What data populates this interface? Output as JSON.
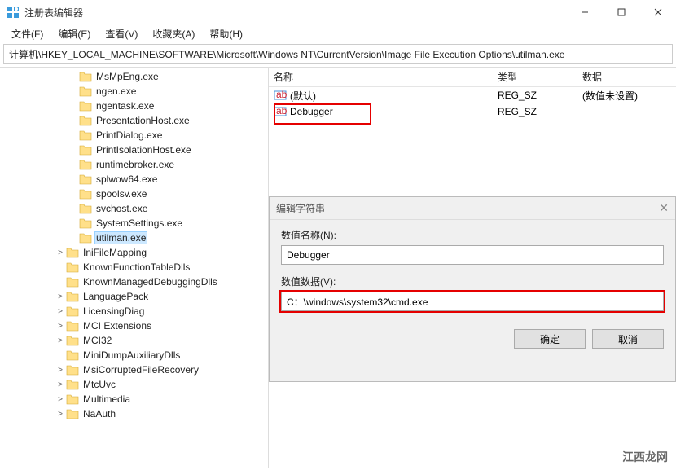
{
  "titlebar": {
    "title": "注册表编辑器"
  },
  "menu": {
    "file": "文件(F)",
    "edit": "编辑(E)",
    "view": "查看(V)",
    "favorites": "收藏夹(A)",
    "help": "帮助(H)"
  },
  "address": "计算机\\HKEY_LOCAL_MACHINE\\SOFTWARE\\Microsoft\\Windows NT\\CurrentVersion\\Image File Execution Options\\utilman.exe",
  "tree": [
    {
      "indent": 5,
      "expand": "",
      "label": "MsMpEng.exe"
    },
    {
      "indent": 5,
      "expand": "",
      "label": "ngen.exe"
    },
    {
      "indent": 5,
      "expand": "",
      "label": "ngentask.exe"
    },
    {
      "indent": 5,
      "expand": "",
      "label": "PresentationHost.exe"
    },
    {
      "indent": 5,
      "expand": "",
      "label": "PrintDialog.exe"
    },
    {
      "indent": 5,
      "expand": "",
      "label": "PrintIsolationHost.exe"
    },
    {
      "indent": 5,
      "expand": "",
      "label": "runtimebroker.exe"
    },
    {
      "indent": 5,
      "expand": "",
      "label": "splwow64.exe"
    },
    {
      "indent": 5,
      "expand": "",
      "label": "spoolsv.exe"
    },
    {
      "indent": 5,
      "expand": "",
      "label": "svchost.exe"
    },
    {
      "indent": 5,
      "expand": "",
      "label": "SystemSettings.exe"
    },
    {
      "indent": 5,
      "expand": "",
      "label": "utilman.exe",
      "selected": true
    },
    {
      "indent": 4,
      "expand": ">",
      "label": "IniFileMapping"
    },
    {
      "indent": 4,
      "expand": "",
      "label": "KnownFunctionTableDlls"
    },
    {
      "indent": 4,
      "expand": "",
      "label": "KnownManagedDebuggingDlls"
    },
    {
      "indent": 4,
      "expand": ">",
      "label": "LanguagePack"
    },
    {
      "indent": 4,
      "expand": ">",
      "label": "LicensingDiag"
    },
    {
      "indent": 4,
      "expand": ">",
      "label": "MCI Extensions"
    },
    {
      "indent": 4,
      "expand": ">",
      "label": "MCI32"
    },
    {
      "indent": 4,
      "expand": "",
      "label": "MiniDumpAuxiliaryDlls"
    },
    {
      "indent": 4,
      "expand": ">",
      "label": "MsiCorruptedFileRecovery"
    },
    {
      "indent": 4,
      "expand": ">",
      "label": "MtcUvc"
    },
    {
      "indent": 4,
      "expand": ">",
      "label": "Multimedia"
    },
    {
      "indent": 4,
      "expand": ">",
      "label": "NaAuth"
    }
  ],
  "list": {
    "headers": {
      "name": "名称",
      "type": "类型",
      "data": "数据"
    },
    "rows": [
      {
        "name": "(默认)",
        "type": "REG_SZ",
        "data": "(数值未设置)"
      },
      {
        "name": "Debugger",
        "type": "REG_SZ",
        "data": ""
      }
    ]
  },
  "dialog": {
    "title": "编辑字符串",
    "name_label": "数值名称(N):",
    "name_value": "Debugger",
    "data_label": "数值数据(V):",
    "data_value": "C：\\windows\\system32\\cmd.exe",
    "ok": "确定",
    "cancel": "取消"
  },
  "watermark": "江西龙网"
}
